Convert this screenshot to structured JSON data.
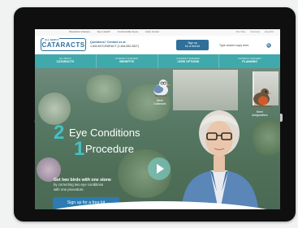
{
  "utility_bar": {
    "links": [
      "Wearable Glasses",
      "Eye Health",
      "Comfortable Eyes",
      "Help Center"
    ],
    "right": [
      "Site Map",
      "Glossary",
      "Español"
    ]
  },
  "header": {
    "logo_prefix": "ALL ABOUT",
    "logo_name": "CATARACTS",
    "question_line1": "Questions? Contact us at",
    "question_line2": "1-844-MYCATARACT (1-844-692-2827)",
    "signup_line1": "Sign up",
    "signup_line2": "for a free kit",
    "search_placeholder": "Type search copy here",
    "search_icon": "search-icon"
  },
  "nav": [
    {
      "sup": "ALL ABOUT",
      "label": "CATARACTS"
    },
    {
      "sup": "CATARACT SURGERY",
      "label": "BENEFITS"
    },
    {
      "sup": "CATARACT SURGERY",
      "label": "LENS OPTIONS"
    },
    {
      "sup": "CATARACT SURGERY",
      "label": "PLANNING"
    }
  ],
  "hero": {
    "num1": "2",
    "headline1": "Eye Conditions",
    "num2": "1",
    "headline2": "Procedure",
    "sub_bold": "Get two birds with one stone",
    "sub_line1": "by correcting two eye conditions",
    "sub_line2": "with one procedure.",
    "cta": "Sign up for a free kit",
    "bird_left_label1": "Meet",
    "bird_left_label2": "Cataracts",
    "bird_right_label1": "Meet",
    "bird_right_label2": "Astigmatism",
    "accent": "#45c1c3",
    "nav_color": "#3fa9ab",
    "button_color": "#2d7bb0"
  }
}
